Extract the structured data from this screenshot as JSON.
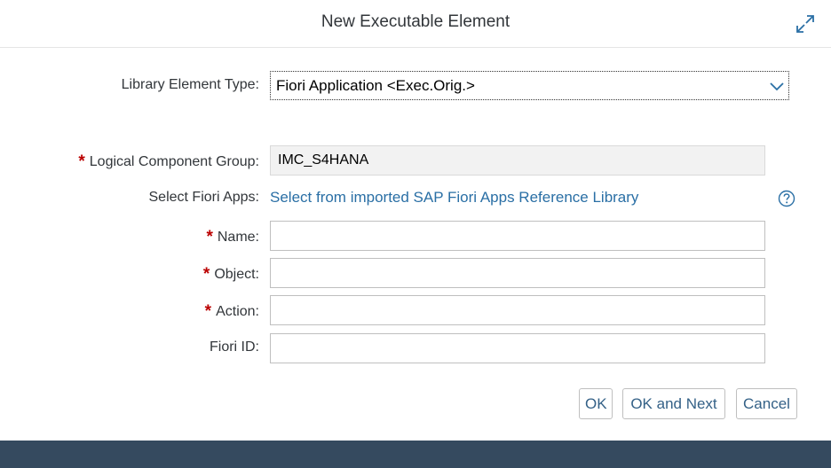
{
  "dialog": {
    "title": "New Executable Element"
  },
  "form": {
    "library_type": {
      "label": "Library Element Type:",
      "value": "Fiori Application <Exec.Orig.>"
    },
    "logical_component_group": {
      "required": "*",
      "label": "Logical Component Group:",
      "value": "IMC_S4HANA"
    },
    "select_fiori_apps": {
      "label": "Select Fiori Apps:",
      "link": "Select from imported SAP Fiori Apps Reference Library"
    },
    "name": {
      "required": "*",
      "label": "Name:",
      "value": ""
    },
    "object": {
      "required": "*",
      "label": "Object:",
      "value": ""
    },
    "action": {
      "required": "*",
      "label": "Action:",
      "value": ""
    },
    "fiori_id": {
      "label": "Fiori ID:",
      "value": ""
    }
  },
  "buttons": {
    "ok": "OK",
    "ok_next": "OK and Next",
    "cancel": "Cancel"
  },
  "icons": {
    "resize": "resize-icon",
    "dropdown": "chevron-down-icon",
    "help": "help-icon"
  },
  "colors": {
    "required": "#bb0000",
    "link": "#2a6fa5",
    "button_text": "#346187",
    "footer": "#354a5f"
  }
}
